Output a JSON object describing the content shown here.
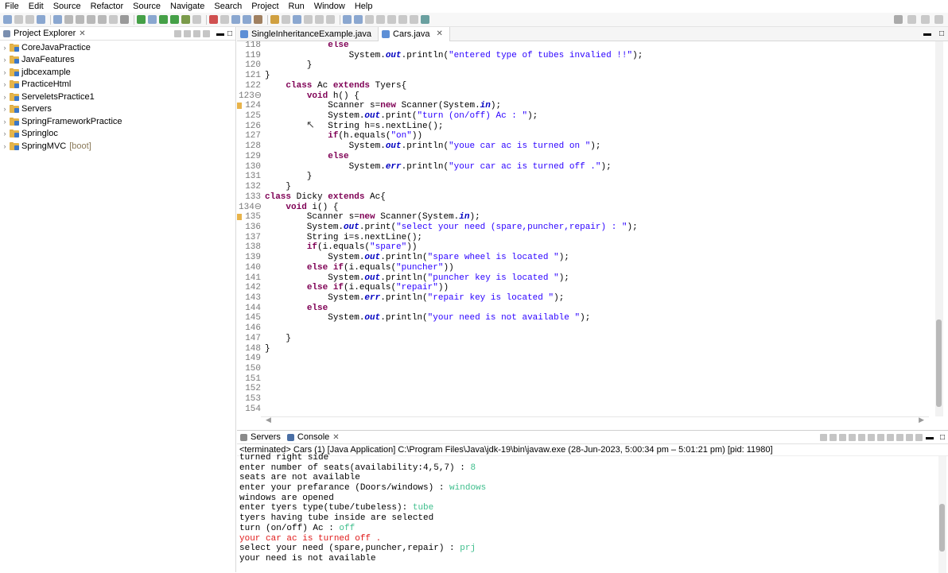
{
  "menu": [
    "File",
    "Edit",
    "Source",
    "Refactor",
    "Source",
    "Navigate",
    "Search",
    "Project",
    "Run",
    "Window",
    "Help"
  ],
  "explorer": {
    "tab_label": "Project Explorer",
    "projects": [
      {
        "name": "CoreJavaPractice",
        "decoration": ""
      },
      {
        "name": "JavaFeatures",
        "decoration": ""
      },
      {
        "name": "jdbcexample",
        "decoration": ""
      },
      {
        "name": "PracticeHtml",
        "decoration": ""
      },
      {
        "name": "ServeletsPractice1",
        "decoration": ""
      },
      {
        "name": "Servers",
        "decoration": ""
      },
      {
        "name": "SpringFrameworkPractice",
        "decoration": ""
      },
      {
        "name": "Springloc",
        "decoration": ""
      },
      {
        "name": "SpringMVC",
        "decoration": "[boot]"
      }
    ]
  },
  "editor": {
    "tabs": [
      {
        "label": "SingleInheritanceExample.java",
        "active": false
      },
      {
        "label": "Cars.java",
        "active": true
      }
    ],
    "lines": [
      {
        "n": "118",
        "warn": false,
        "segs": [
          [
            "t",
            "            "
          ],
          [
            "kw",
            "else"
          ]
        ]
      },
      {
        "n": "119",
        "warn": false,
        "segs": [
          [
            "t",
            "                System."
          ],
          [
            "fld",
            "out"
          ],
          [
            "t",
            ".println("
          ],
          [
            "str",
            "\"entered type of tubes invalied !!\""
          ],
          [
            "t",
            ");"
          ]
        ]
      },
      {
        "n": "120",
        "warn": false,
        "segs": [
          [
            "t",
            "        }"
          ]
        ]
      },
      {
        "n": "121",
        "warn": false,
        "segs": [
          [
            "t",
            "}"
          ]
        ]
      },
      {
        "n": "122",
        "warn": false,
        "segs": [
          [
            "t",
            "    "
          ],
          [
            "kw",
            "class"
          ],
          [
            "t",
            " Ac "
          ],
          [
            "kw",
            "extends"
          ],
          [
            "t",
            " Tyers{"
          ]
        ]
      },
      {
        "n": "123⊖",
        "warn": false,
        "segs": [
          [
            "t",
            "        "
          ],
          [
            "kw",
            "void"
          ],
          [
            "t",
            " h() {"
          ]
        ]
      },
      {
        "n": "124",
        "warn": true,
        "segs": [
          [
            "t",
            "            Scanner s="
          ],
          [
            "kw",
            "new"
          ],
          [
            "t",
            " Scanner(System."
          ],
          [
            "fld",
            "in"
          ],
          [
            "t",
            ");"
          ]
        ]
      },
      {
        "n": "125",
        "warn": false,
        "segs": [
          [
            "t",
            "            System."
          ],
          [
            "fld",
            "out"
          ],
          [
            "t",
            ".print("
          ],
          [
            "str",
            "\"turn (on/off) Ac : \""
          ],
          [
            "t",
            ");"
          ]
        ]
      },
      {
        "n": "126",
        "warn": false,
        "segs": [
          [
            "t",
            "            String h=s.nextLine();"
          ]
        ]
      },
      {
        "n": "127",
        "warn": false,
        "segs": [
          [
            "t",
            "            "
          ],
          [
            "kw",
            "if"
          ],
          [
            "t",
            "(h.equals("
          ],
          [
            "str",
            "\"on\""
          ],
          [
            "t",
            "))"
          ]
        ]
      },
      {
        "n": "128",
        "warn": false,
        "segs": [
          [
            "t",
            "                System."
          ],
          [
            "fld",
            "out"
          ],
          [
            "t",
            ".println("
          ],
          [
            "str",
            "\"youe car ac is turned on \""
          ],
          [
            "t",
            ");"
          ]
        ]
      },
      {
        "n": "129",
        "warn": false,
        "segs": [
          [
            "t",
            "            "
          ],
          [
            "kw",
            "else"
          ]
        ]
      },
      {
        "n": "130",
        "warn": false,
        "segs": [
          [
            "t",
            "                System."
          ],
          [
            "fld",
            "err"
          ],
          [
            "t",
            ".println("
          ],
          [
            "str",
            "\"your car ac is turned off .\""
          ],
          [
            "t",
            ");"
          ]
        ]
      },
      {
        "n": "131",
        "warn": false,
        "segs": [
          [
            "t",
            "        }"
          ]
        ]
      },
      {
        "n": "132",
        "warn": false,
        "segs": [
          [
            "t",
            "    }"
          ]
        ]
      },
      {
        "n": "133",
        "warn": false,
        "segs": [
          [
            "kw",
            "class"
          ],
          [
            "t",
            " Dicky "
          ],
          [
            "kw",
            "extends"
          ],
          [
            "t",
            " Ac{"
          ]
        ]
      },
      {
        "n": "134⊖",
        "warn": false,
        "segs": [
          [
            "t",
            "    "
          ],
          [
            "kw",
            "void"
          ],
          [
            "t",
            " i() {"
          ]
        ]
      },
      {
        "n": "135",
        "warn": true,
        "segs": [
          [
            "t",
            "        Scanner s="
          ],
          [
            "kw",
            "new"
          ],
          [
            "t",
            " Scanner(System."
          ],
          [
            "fld",
            "in"
          ],
          [
            "t",
            ");"
          ]
        ]
      },
      {
        "n": "136",
        "warn": false,
        "segs": [
          [
            "t",
            "        System."
          ],
          [
            "fld",
            "out"
          ],
          [
            "t",
            ".print("
          ],
          [
            "str",
            "\"select your need (spare,puncher,repair) : \""
          ],
          [
            "t",
            ");"
          ]
        ]
      },
      {
        "n": "137",
        "warn": false,
        "segs": [
          [
            "t",
            "        String i=s.nextLine();"
          ]
        ]
      },
      {
        "n": "138",
        "warn": false,
        "segs": [
          [
            "t",
            "        "
          ],
          [
            "kw",
            "if"
          ],
          [
            "t",
            "(i.equals("
          ],
          [
            "str",
            "\"spare\""
          ],
          [
            "t",
            "))"
          ]
        ]
      },
      {
        "n": "139",
        "warn": false,
        "segs": [
          [
            "t",
            "            System."
          ],
          [
            "fld",
            "out"
          ],
          [
            "t",
            ".println("
          ],
          [
            "str",
            "\"spare wheel is located \""
          ],
          [
            "t",
            ");"
          ]
        ]
      },
      {
        "n": "140",
        "warn": false,
        "segs": [
          [
            "t",
            "        "
          ],
          [
            "kw",
            "else if"
          ],
          [
            "t",
            "(i.equals("
          ],
          [
            "str",
            "\"puncher\""
          ],
          [
            "t",
            "))"
          ]
        ]
      },
      {
        "n": "141",
        "warn": false,
        "segs": [
          [
            "t",
            "            System."
          ],
          [
            "fld",
            "out"
          ],
          [
            "t",
            ".println("
          ],
          [
            "str",
            "\"puncher key is located \""
          ],
          [
            "t",
            ");"
          ]
        ]
      },
      {
        "n": "142",
        "warn": false,
        "segs": [
          [
            "t",
            "        "
          ],
          [
            "kw",
            "else if"
          ],
          [
            "t",
            "(i.equals("
          ],
          [
            "str",
            "\"repair\""
          ],
          [
            "t",
            "))"
          ]
        ]
      },
      {
        "n": "143",
        "warn": false,
        "segs": [
          [
            "t",
            "            System."
          ],
          [
            "fld",
            "err"
          ],
          [
            "t",
            ".println("
          ],
          [
            "str",
            "\"repair key is located \""
          ],
          [
            "t",
            ");"
          ]
        ]
      },
      {
        "n": "144",
        "warn": false,
        "segs": [
          [
            "t",
            "        "
          ],
          [
            "kw",
            "else"
          ]
        ]
      },
      {
        "n": "145",
        "warn": false,
        "segs": [
          [
            "t",
            "            System."
          ],
          [
            "fld",
            "out"
          ],
          [
            "t",
            ".println("
          ],
          [
            "str",
            "\"your need is not available \""
          ],
          [
            "t",
            ");"
          ]
        ]
      },
      {
        "n": "146",
        "warn": false,
        "segs": [
          [
            "t",
            ""
          ]
        ]
      },
      {
        "n": "147",
        "warn": false,
        "segs": [
          [
            "t",
            "    }"
          ]
        ]
      },
      {
        "n": "148",
        "warn": false,
        "segs": [
          [
            "t",
            "}"
          ]
        ]
      },
      {
        "n": "149",
        "warn": false,
        "segs": [
          [
            "t",
            ""
          ]
        ]
      },
      {
        "n": "150",
        "warn": false,
        "segs": [
          [
            "t",
            ""
          ]
        ]
      },
      {
        "n": "151",
        "warn": false,
        "segs": [
          [
            "t",
            ""
          ]
        ]
      },
      {
        "n": "152",
        "warn": false,
        "segs": [
          [
            "t",
            ""
          ]
        ]
      },
      {
        "n": "153",
        "warn": false,
        "segs": [
          [
            "t",
            ""
          ]
        ]
      },
      {
        "n": "154",
        "warn": false,
        "segs": [
          [
            "t",
            ""
          ]
        ]
      }
    ]
  },
  "console": {
    "tabs": [
      "Servers",
      "Console"
    ],
    "status": "<terminated> Cars (1) [Java Application] C:\\Program Files\\Java\\jdk-19\\bin\\javaw.exe  (28-Jun-2023, 5:00:34 pm – 5:01:21 pm) [pid: 11980]",
    "lines": [
      {
        "segs": [
          [
            "t",
            "turned right side"
          ]
        ]
      },
      {
        "segs": [
          [
            "t",
            "enter number of seats(availability:4,5,7) : "
          ],
          [
            "in",
            "8"
          ]
        ]
      },
      {
        "segs": [
          [
            "t",
            "seats are not available"
          ]
        ]
      },
      {
        "segs": [
          [
            "t",
            "enter your prefarance (Doors/windows) : "
          ],
          [
            "in",
            "windows"
          ]
        ]
      },
      {
        "segs": [
          [
            "t",
            "windows are opened"
          ]
        ]
      },
      {
        "segs": [
          [
            "t",
            "enter tyers type(tube/tubeless): "
          ],
          [
            "in",
            "tube"
          ]
        ]
      },
      {
        "segs": [
          [
            "t",
            "tyers having tube inside are selected"
          ]
        ]
      },
      {
        "segs": [
          [
            "t",
            "turn (on/off) Ac : "
          ],
          [
            "in",
            "off"
          ]
        ]
      },
      {
        "segs": [
          [
            "err",
            "your car ac is turned off ."
          ]
        ]
      },
      {
        "segs": [
          [
            "t",
            "select your need (spare,puncher,repair) : "
          ],
          [
            "in",
            "prj"
          ]
        ]
      },
      {
        "segs": [
          [
            "t",
            "your need is not available"
          ]
        ]
      }
    ]
  },
  "colors": {
    "keyword": "#7f0055",
    "string": "#2a00ff",
    "field": "#0000c0",
    "console_input": "#3ebe8c",
    "console_error": "#e01b1b",
    "folder": "#e4b44a"
  }
}
